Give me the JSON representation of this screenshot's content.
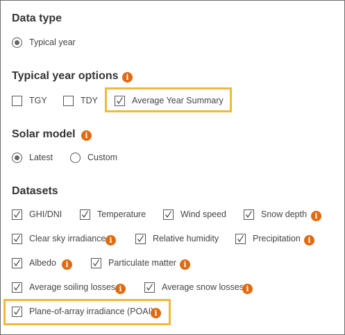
{
  "data_type": {
    "heading": "Data type",
    "options": [
      {
        "label": "Typical year",
        "selected": true
      }
    ]
  },
  "typical_year_options": {
    "heading": "Typical year options",
    "options": [
      {
        "label": "TGY",
        "checked": false
      },
      {
        "label": "TDY",
        "checked": false
      },
      {
        "label": "Average Year Summary",
        "checked": true
      }
    ]
  },
  "solar_model": {
    "heading": "Solar model",
    "options": [
      {
        "label": "Latest",
        "selected": true
      },
      {
        "label": "Custom",
        "selected": false
      }
    ]
  },
  "datasets": {
    "heading": "Datasets",
    "items": [
      {
        "label": "GHI/DNI",
        "checked": true,
        "info": false
      },
      {
        "label": "Temperature",
        "checked": true,
        "info": false
      },
      {
        "label": "Wind speed",
        "checked": true,
        "info": false
      },
      {
        "label": "Snow depth",
        "checked": true,
        "info": true
      },
      {
        "label": "Clear sky irradiance",
        "checked": true,
        "info": true
      },
      {
        "label": "Relative humidity",
        "checked": true,
        "info": false
      },
      {
        "label": "Precipitation",
        "checked": true,
        "info": true
      },
      {
        "label": "Albedo",
        "checked": true,
        "info": true
      },
      {
        "label": "Particulate matter",
        "checked": true,
        "info": true
      },
      {
        "label": "Average soiling losses",
        "checked": true,
        "info": true
      },
      {
        "label": "Average snow losses",
        "checked": true,
        "info": true
      },
      {
        "label": "Plane-of-array irradiance (POAI)",
        "checked": true,
        "info": true
      }
    ]
  },
  "info_glyph": "i",
  "colors": {
    "info": "#e06a10",
    "highlight": "#f0b93a"
  },
  "icons": {
    "info": "info-icon",
    "checkmark": "checkmark-icon"
  }
}
